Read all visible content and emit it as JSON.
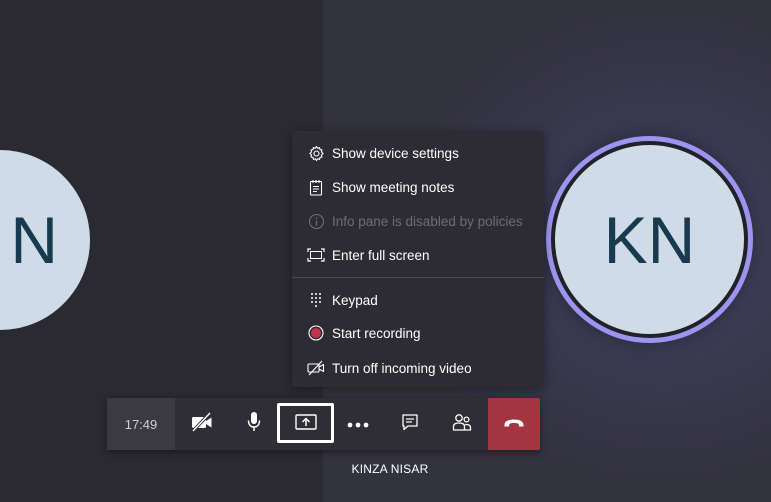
{
  "participants": {
    "left_initial": "N",
    "right_initials": "KN",
    "right_name": "KINZA NISAR"
  },
  "more_menu": {
    "items": [
      {
        "label": "Show device settings",
        "icon": "gear-icon",
        "enabled": true
      },
      {
        "label": "Show meeting notes",
        "icon": "notes-icon",
        "enabled": true
      },
      {
        "label": "Info pane is disabled by policies",
        "icon": "info-icon",
        "enabled": false
      },
      {
        "label": "Enter full screen",
        "icon": "fullscreen-icon",
        "enabled": true
      },
      {
        "label": "Keypad",
        "icon": "keypad-icon",
        "enabled": true
      },
      {
        "label": "Start recording",
        "icon": "record-icon",
        "enabled": true
      },
      {
        "label": "Turn off incoming video",
        "icon": "video-off-icon",
        "enabled": true
      }
    ]
  },
  "call_controls": {
    "duration": "17:49",
    "buttons": [
      "camera-off-icon",
      "microphone-icon",
      "share-screen-icon",
      "more-actions-icon",
      "chat-icon",
      "participants-icon",
      "hang-up-icon"
    ]
  },
  "colors": {
    "accent_ring": "#9c95f0",
    "hangup": "#a4343f",
    "record": "#c4314b",
    "avatar_bg": "#cfdbe6",
    "avatar_text": "#183a4f"
  }
}
